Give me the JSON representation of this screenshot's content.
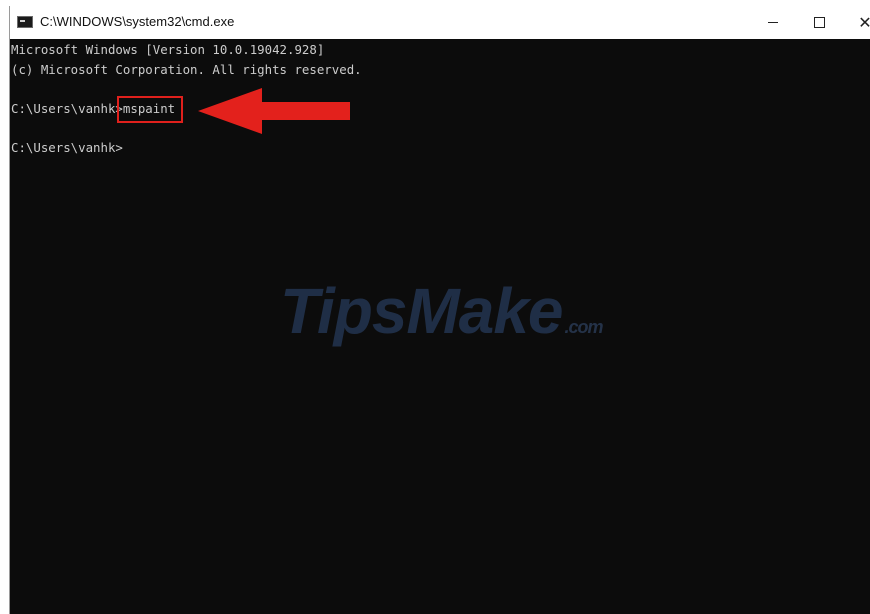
{
  "window": {
    "title": "C:\\WINDOWS\\system32\\cmd.exe",
    "icon": "cmd-icon",
    "controls": {
      "minimize_icon": "minimize-icon",
      "maximize_icon": "maximize-icon",
      "close_glyph": "✕"
    }
  },
  "console": {
    "lines": [
      "Microsoft Windows [Version 10.0.19042.928]",
      "(c) Microsoft Corporation. All rights reserved.",
      "C:\\Users\\vanhk>mspaint",
      "C:\\Users\\vanhk>"
    ],
    "text_color": "#cccccc",
    "background_color": "#0c0c0c"
  },
  "annotation": {
    "highlighted_text": "mspaint",
    "color": "#e0201c",
    "arrow_icon": "left-arrow-icon"
  },
  "watermark": {
    "brand": "TipsMake",
    "suffix": ".com"
  }
}
